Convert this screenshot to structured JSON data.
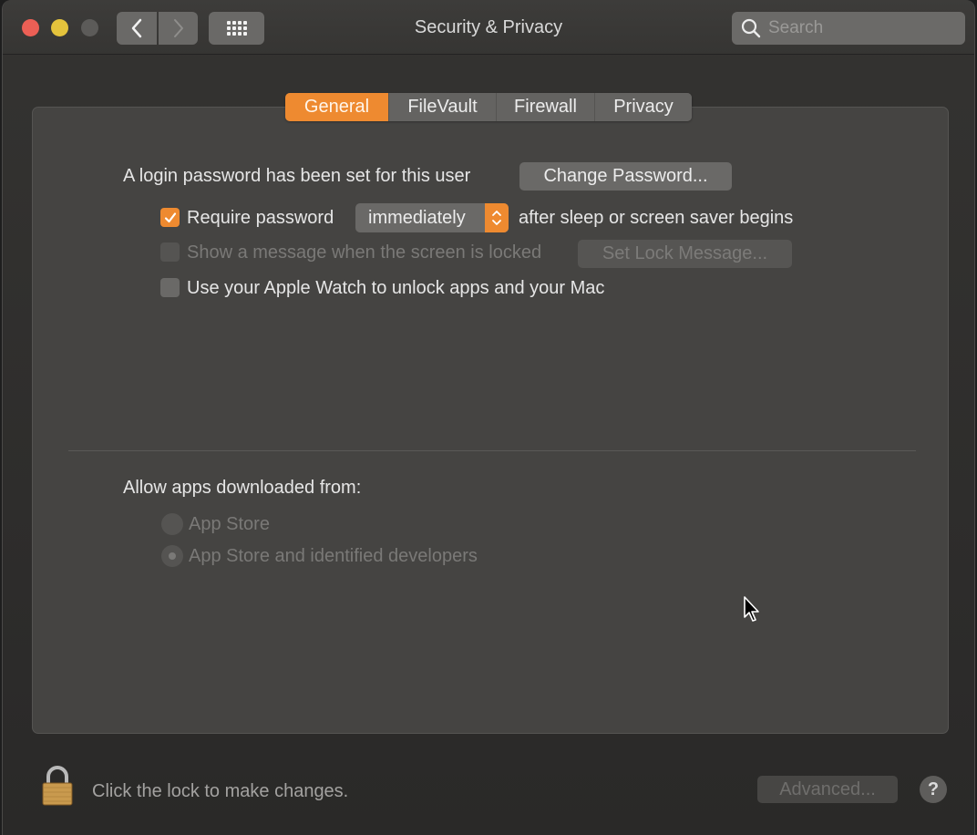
{
  "window": {
    "title": "Security & Privacy",
    "traffic_lights": {
      "close": "#ec5f55",
      "minimize": "#e4c33c",
      "zoom": "#5c5b59"
    }
  },
  "toolbar": {
    "back_icon": "chevron-left-icon",
    "forward_icon": "chevron-right-icon",
    "show_all_icon": "grid-icon",
    "search": {
      "placeholder": "Search",
      "value": ""
    }
  },
  "tabs": [
    {
      "label": "General",
      "active": true
    },
    {
      "label": "FileVault",
      "active": false
    },
    {
      "label": "Firewall",
      "active": false
    },
    {
      "label": "Privacy",
      "active": false
    }
  ],
  "general": {
    "login_password_text": "A login password has been set for this user",
    "change_password_label": "Change Password...",
    "require_password": {
      "label": "Require password",
      "checked": true,
      "selected_option": "immediately",
      "suffix": "after sleep or screen saver begins"
    },
    "show_message": {
      "label": "Show a message when the screen is locked",
      "checked": false,
      "enabled": false,
      "button_label": "Set Lock Message..."
    },
    "apple_watch": {
      "label": "Use your Apple Watch to unlock apps and your Mac",
      "checked": false
    },
    "allow_apps": {
      "heading": "Allow apps downloaded from:",
      "options": [
        {
          "label": "App Store",
          "selected": false,
          "enabled": false
        },
        {
          "label": "App Store and identified developers",
          "selected": true,
          "enabled": false
        }
      ]
    }
  },
  "footer": {
    "lock_text": "Click the lock to make changes.",
    "advanced_label": "Advanced...",
    "help_label": "?"
  },
  "colors": {
    "accent": "#ee8a30",
    "panel": "#454442",
    "window": "#2c2b2a"
  }
}
